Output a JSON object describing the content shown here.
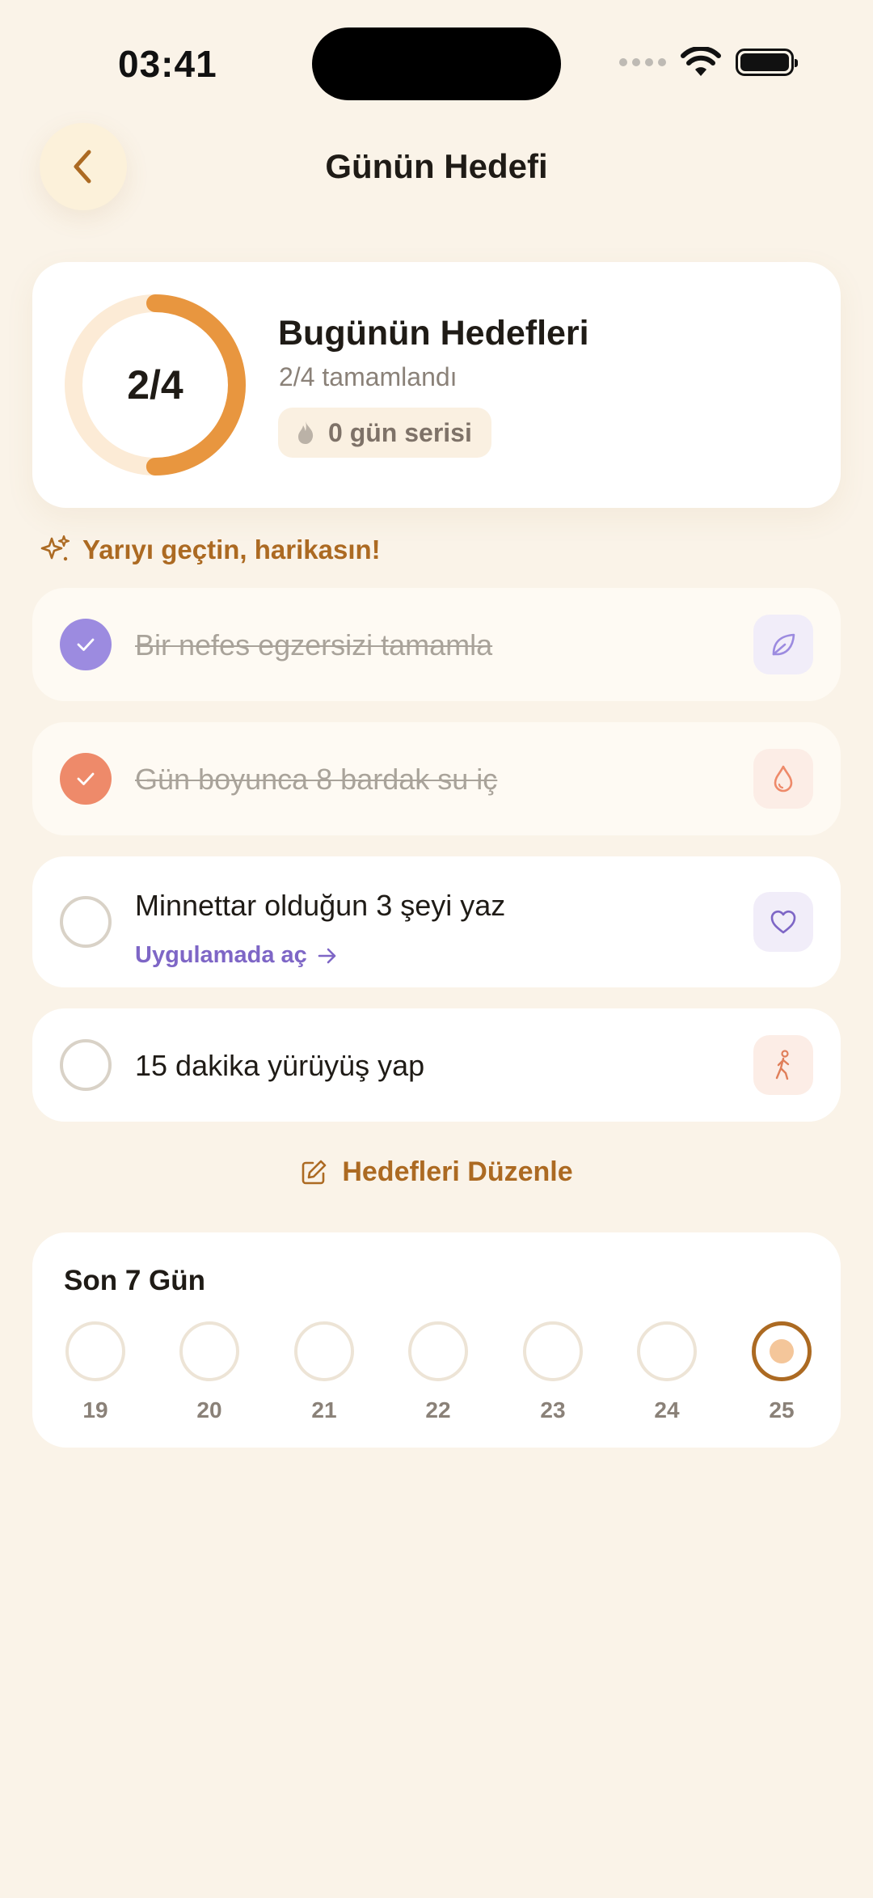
{
  "status_bar": {
    "time": "03:41"
  },
  "header": {
    "title": "Günün Hedefi",
    "back_icon": "chevron-left-icon"
  },
  "summary": {
    "progress_label": "2/4",
    "progress_fraction": 0.5,
    "title": "Bugünün Hedefleri",
    "subtitle": "2/4 tamamlandı",
    "streak_label": "0 gün serisi",
    "streak_icon": "flame-icon"
  },
  "encouragement": {
    "icon": "sparkles-icon",
    "text": "Yarıyı geçtin, harikasın!"
  },
  "goals": [
    {
      "text": "Bir nefes egzersizi tamamla",
      "done": true,
      "icon": "leaf-icon",
      "color": "#9C8BE0"
    },
    {
      "text": "Gün boyunca 8 bardak su iç",
      "done": true,
      "icon": "water-drop-icon",
      "color": "#EE8A6A"
    },
    {
      "text": "Minnettar olduğun 3 şeyi yaz",
      "done": false,
      "icon": "heart-icon",
      "link": "Uygulamada aç",
      "color": "#7E66C6"
    },
    {
      "text": "15 dakika yürüyüş yap",
      "done": false,
      "icon": "walking-icon",
      "color": "#E07F5A"
    }
  ],
  "edit_button": {
    "label": "Hedefleri Düzenle",
    "icon": "edit-icon"
  },
  "week": {
    "title": "Son 7 Gün",
    "days": [
      "19",
      "20",
      "21",
      "22",
      "23",
      "24",
      "25"
    ],
    "today": "25"
  },
  "colors": {
    "background": "#FAF3E8",
    "accent": "#AC6A22",
    "ring_fill": "#E8963F",
    "ring_track": "#FCEBD6",
    "link": "#7E66C6"
  }
}
